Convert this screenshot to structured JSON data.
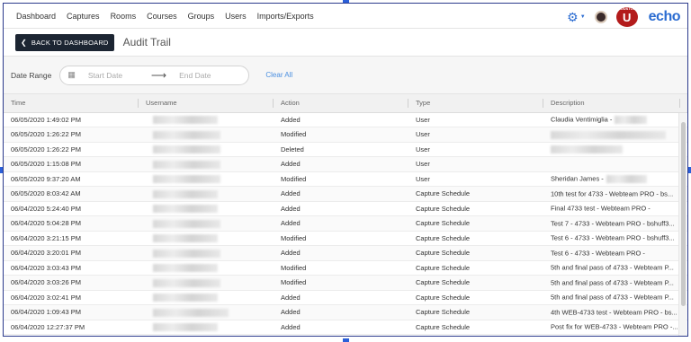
{
  "nav": {
    "items": [
      {
        "label": "Dashboard"
      },
      {
        "label": "Captures"
      },
      {
        "label": "Rooms"
      },
      {
        "label": "Courses"
      },
      {
        "label": "Groups"
      },
      {
        "label": "Users"
      },
      {
        "label": "Imports/Exports"
      }
    ],
    "logo_text": "echo",
    "brand_letter": "U",
    "brand_caption": "HOUSTON"
  },
  "header": {
    "back_label": "BACK TO DASHBOARD",
    "title": "Audit Trail"
  },
  "filter": {
    "label": "Date Range",
    "start_placeholder": "Start Date",
    "end_placeholder": "End Date",
    "clear_label": "Clear All"
  },
  "table": {
    "columns": [
      "Time",
      "Username",
      "Action",
      "Type",
      "Description"
    ],
    "rows": [
      {
        "time": "06/05/2020 1:49:02 PM",
        "action": "Added",
        "type": "User",
        "description": "Claudia Ventimiglia -"
      },
      {
        "time": "06/05/2020 1:26:22 PM",
        "action": "Modified",
        "type": "User",
        "description": ""
      },
      {
        "time": "06/05/2020 1:26:22 PM",
        "action": "Deleted",
        "type": "User",
        "description": ""
      },
      {
        "time": "06/05/2020 1:15:08 PM",
        "action": "Added",
        "type": "User",
        "description": ""
      },
      {
        "time": "06/05/2020 9:37:20 AM",
        "action": "Modified",
        "type": "User",
        "description": "Sheridan James -"
      },
      {
        "time": "06/05/2020 8:03:42 AM",
        "action": "Added",
        "type": "Capture Schedule",
        "description": "10th test for 4733 - Webteam PRO - bs..."
      },
      {
        "time": "06/04/2020 5:24:40 PM",
        "action": "Added",
        "type": "Capture Schedule",
        "description": "Final 4733 test - Webteam PRO -"
      },
      {
        "time": "06/04/2020 5:04:28 PM",
        "action": "Added",
        "type": "Capture Schedule",
        "description": "Test 7 - 4733 - Webteam PRO - bshuff3..."
      },
      {
        "time": "06/04/2020 3:21:15 PM",
        "action": "Modified",
        "type": "Capture Schedule",
        "description": "Test 6 - 4733 - Webteam PRO - bshuff3..."
      },
      {
        "time": "06/04/2020 3:20:01 PM",
        "action": "Added",
        "type": "Capture Schedule",
        "description": "Test 6 - 4733 - Webteam PRO -"
      },
      {
        "time": "06/04/2020 3:03:43 PM",
        "action": "Modified",
        "type": "Capture Schedule",
        "description": "5th and final pass of 4733 - Webteam P..."
      },
      {
        "time": "06/04/2020 3:03:26 PM",
        "action": "Modified",
        "type": "Capture Schedule",
        "description": "5th and final pass of 4733 - Webteam P..."
      },
      {
        "time": "06/04/2020 3:02:41 PM",
        "action": "Added",
        "type": "Capture Schedule",
        "description": "5th and final pass of 4733 - Webteam P..."
      },
      {
        "time": "06/04/2020 1:09:43 PM",
        "action": "Added",
        "type": "Capture Schedule",
        "description": "4th WEB-4733 test - Webteam PRO - bs..."
      },
      {
        "time": "06/04/2020 12:27:37 PM",
        "action": "Added",
        "type": "Capture Schedule",
        "description": "Post fix for WEB-4733 - Webteam PRO -..."
      }
    ]
  },
  "colors": {
    "accent": "#2b6cd1",
    "back_button_bg": "#1c2532",
    "link": "#4a8fe0",
    "brand_red": "#b31b1b"
  },
  "icons": {
    "settings": "gear-icon",
    "calendar": "calendar-icon",
    "arrow": "arrow-right-icon",
    "back": "chevron-left-icon"
  }
}
